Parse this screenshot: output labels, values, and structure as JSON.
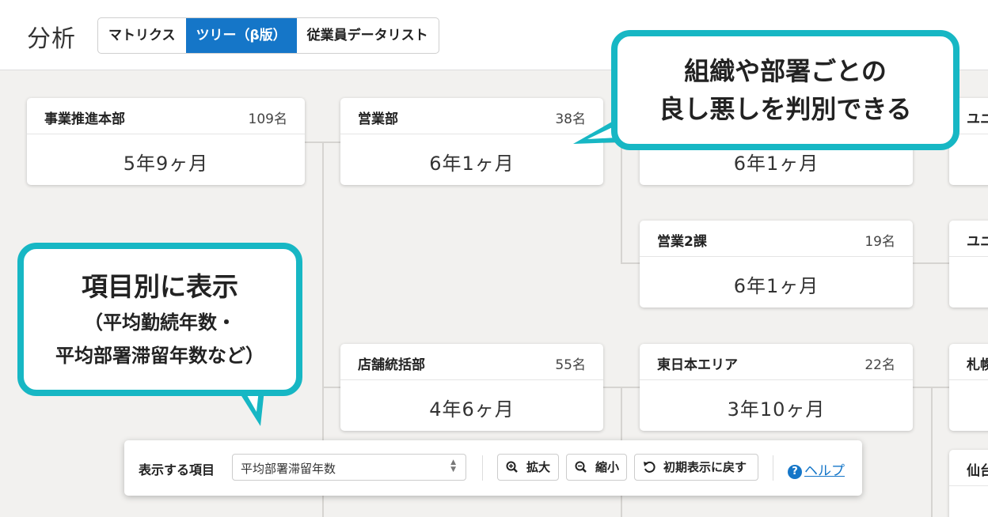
{
  "header": {
    "title": "分析",
    "tabs": [
      {
        "label": "マトリクス"
      },
      {
        "label": "ツリー（β版）"
      },
      {
        "label": "従業員データリスト"
      }
    ]
  },
  "nodes": [
    {
      "name": "事業推進本部",
      "count": "109名",
      "value": "5年9ヶ月"
    },
    {
      "name": "営業部",
      "count": "38名",
      "value": "6年1ヶ月"
    },
    {
      "name": "",
      "count": "",
      "value": "6年1ヶ月"
    },
    {
      "name": "営業2課",
      "count": "19名",
      "value": "6年1ヶ月"
    },
    {
      "name": "店舗統括部",
      "count": "55名",
      "value": "4年6ヶ月"
    },
    {
      "name": "東日本エリア",
      "count": "22名",
      "value": "3年10ヶ月"
    }
  ],
  "partial_nodes": [
    {
      "name": "ユニ"
    },
    {
      "name": "ユニ"
    },
    {
      "name": "札幌"
    },
    {
      "name": "仙台"
    }
  ],
  "callouts": {
    "top": {
      "line1": "組織や部署ごとの",
      "line2": "良し悪しを判別できる"
    },
    "left": {
      "line1": "項目別に表示",
      "line2": "（平均勤続年数・",
      "line3": "平均部署滞留年数など）"
    }
  },
  "toolbar": {
    "label": "表示する項目",
    "select_value": "平均部署滞留年数",
    "zoom_in": "拡大",
    "zoom_out": "縮小",
    "reset": "初期表示に戻す",
    "help": "ヘルプ",
    "help_icon_text": "?"
  },
  "icons": {
    "zoom_in": "zoom-in-icon",
    "zoom_out": "zoom-out-icon",
    "reset": "reset-icon",
    "help": "help-circle-icon"
  },
  "colors": {
    "accent": "#1576c8",
    "callout_border": "#17b7c4"
  }
}
